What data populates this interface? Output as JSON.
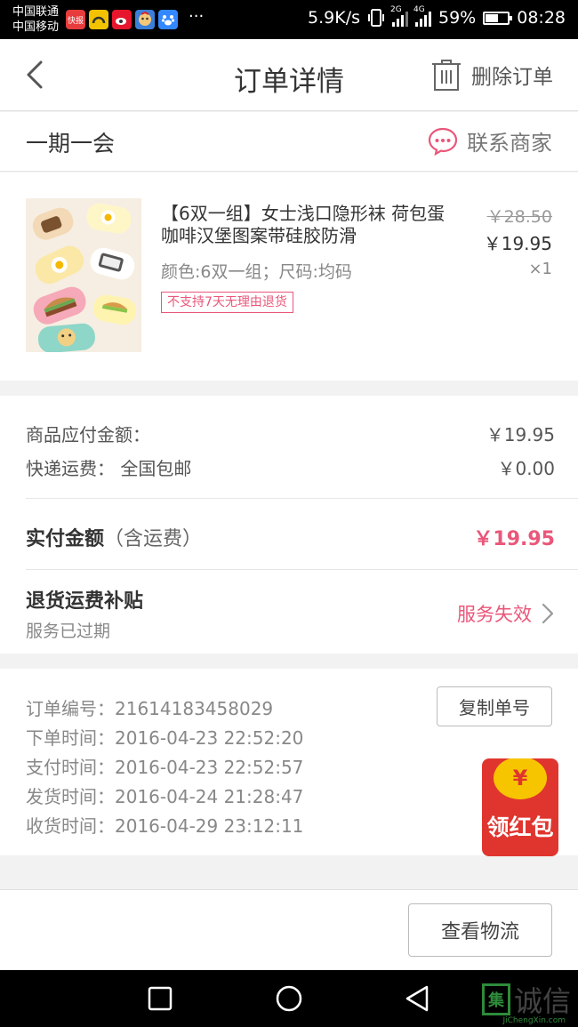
{
  "status_bar": {
    "carrier1": "中国联通",
    "carrier2": "中国移动",
    "app_icons": [
      {
        "name": "kuaibao-icon",
        "label": "快报",
        "color": "#e73c3c"
      },
      {
        "name": "app-yellow-icon",
        "label": "",
        "color": "#f2c200"
      },
      {
        "name": "weibo-icon",
        "label": "",
        "color": "#e6162d"
      },
      {
        "name": "game-icon",
        "label": "",
        "color": "#3b7fd9"
      },
      {
        "name": "baidu-icon",
        "label": "",
        "color": "#3388ff"
      }
    ],
    "more": "···",
    "speed": "5.9K/s",
    "net1": "2G",
    "net2": "4G",
    "battery": "59%",
    "time": "08:28"
  },
  "header": {
    "title": "订单详情",
    "delete_label": "删除订单"
  },
  "shop": {
    "name": "一期一会",
    "contact_label": "联系商家"
  },
  "product": {
    "name": "【6双一组】女士浅口隐形袜  荷包蛋咖啡汉堡图案带硅胶防滑",
    "attrs": "颜色:6双一组；尺码:均码",
    "tag": "不支持7天无理由退货",
    "original_price": "￥28.50",
    "price": "￥19.95",
    "quantity": "×1"
  },
  "amounts": {
    "goods_label": "商品应付金额：",
    "goods_value": "￥19.95",
    "shipping_label": "快递运费：  全国包邮",
    "shipping_value": "￥0.00",
    "paid_label": "实付金额",
    "paid_note": "（含运费）",
    "paid_value": "￥19.95",
    "return_title": "退货运费补贴",
    "return_desc": "服务已过期",
    "return_status": "服务失效"
  },
  "order_info": {
    "number": "订单编号：21614183458029",
    "ordered": "下单时间：2016-04-23   22:52:20",
    "paid": "支付时间：2016-04-23   22:52:57",
    "shipped": "发货时间：2016-04-24   21:28:47",
    "received": "收货时间：2016-04-29   23:12:11",
    "copy_label": "复制单号",
    "red_packet_coin": "¥",
    "red_packet_label": "领红包"
  },
  "footer": {
    "logistics_label": "查看物流"
  },
  "watermark": {
    "box": "集",
    "text": "诚信",
    "sub": "JiChengXin.com"
  },
  "colors": {
    "accent": "#e9577a",
    "red_packet": "#e0352f"
  }
}
